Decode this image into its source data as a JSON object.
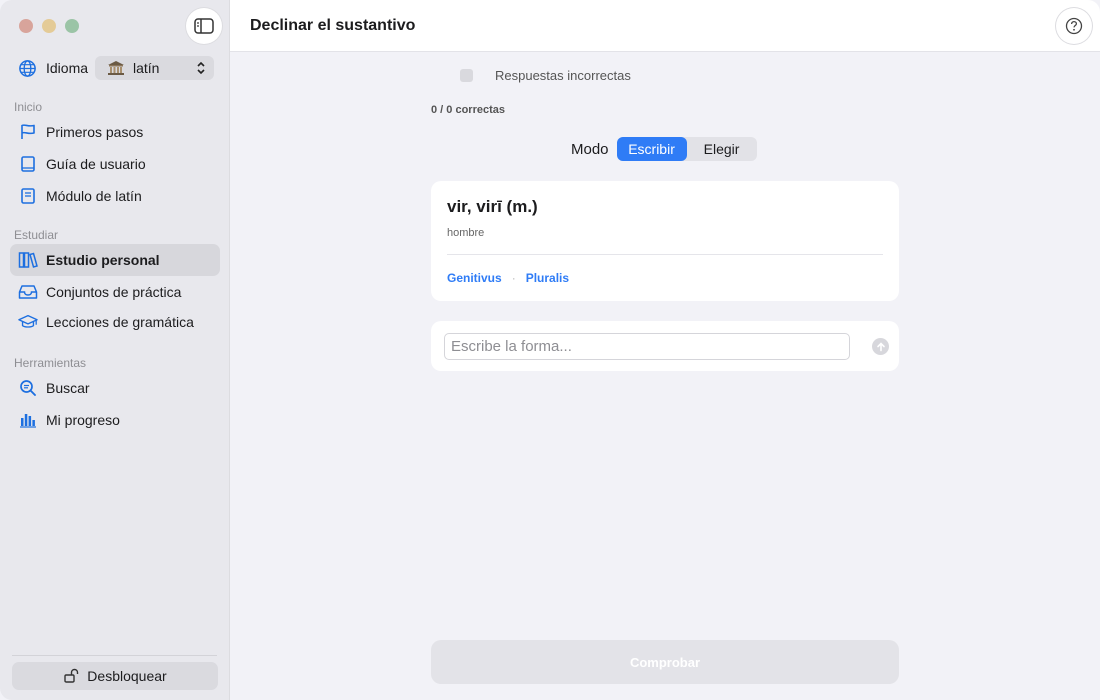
{
  "window": {
    "title": "Declinar el sustantivo"
  },
  "sidebar": {
    "language_label": "Idioma",
    "language_value": "latín",
    "sections": [
      {
        "title": "Inicio",
        "items": [
          "Primeros pasos",
          "Guía de usuario",
          "Módulo de latín"
        ]
      },
      {
        "title": "Estudiar",
        "items": [
          "Estudio personal",
          "Conjuntos de práctica",
          "Lecciones de gramática"
        ]
      },
      {
        "title": "Herramientas",
        "items": [
          "Buscar",
          "Mi progreso"
        ]
      }
    ],
    "active_item": "Estudio personal",
    "unlock_label": "Desbloquear"
  },
  "main": {
    "wrong_answers_label": "Respuestas incorrectas",
    "score": "0 / 0 correctas",
    "mode_label": "Modo",
    "mode_options": [
      "Escribir",
      "Elegir"
    ],
    "mode_selected": "Escribir",
    "card": {
      "word": "vir, virī (m.)",
      "meaning": "hombre",
      "case": "Genitivus",
      "number": "Pluralis"
    },
    "answer_placeholder": "Escribe la forma...",
    "check_label": "Comprobar"
  },
  "colors": {
    "accent": "#2f7cf6",
    "sidebar_bg": "#e8e8ed",
    "content_bg": "#f2f2f7"
  }
}
